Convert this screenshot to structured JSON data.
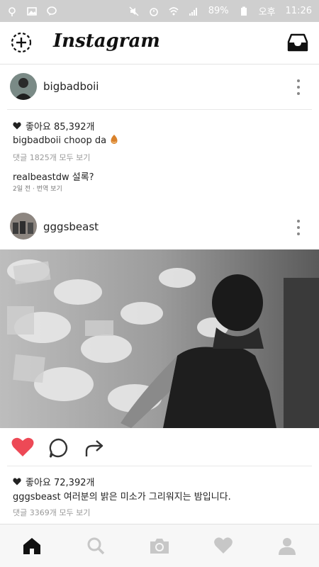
{
  "status_bar": {
    "battery": "89%",
    "time": "오후 11:26",
    "time_prefix": "오후",
    "time_value": "11:26"
  },
  "header": {
    "title": "Instagram",
    "add_icon": "circle-plus-icon",
    "inbox_icon": "inbox-icon"
  },
  "post1": {
    "username": "bigbadboii",
    "likes_label": "좋아요 85,392개",
    "caption_user": "bigbadboii",
    "caption_text": "choop da",
    "view_comments": "댓글 1825개 모두 보기",
    "comment_user": "realbeastdw",
    "comment_text": "설록?",
    "time_ago": "2일 전",
    "translate": "번역 보기"
  },
  "post2": {
    "username": "gggsbeast",
    "likes_label": "좋아요 72,392개",
    "caption_user": "gggsbeast",
    "caption_text": "여러분의 밝은 미소가 그리워지는 밤입니다.",
    "view_comments": "댓글 3369개 모두 보기"
  },
  "bottom_nav": [
    "home-icon",
    "search-icon",
    "camera-icon",
    "heart-icon",
    "profile-icon"
  ],
  "colors": {
    "like_red": "#ed4956",
    "status_bg": "#cfcfcf"
  }
}
